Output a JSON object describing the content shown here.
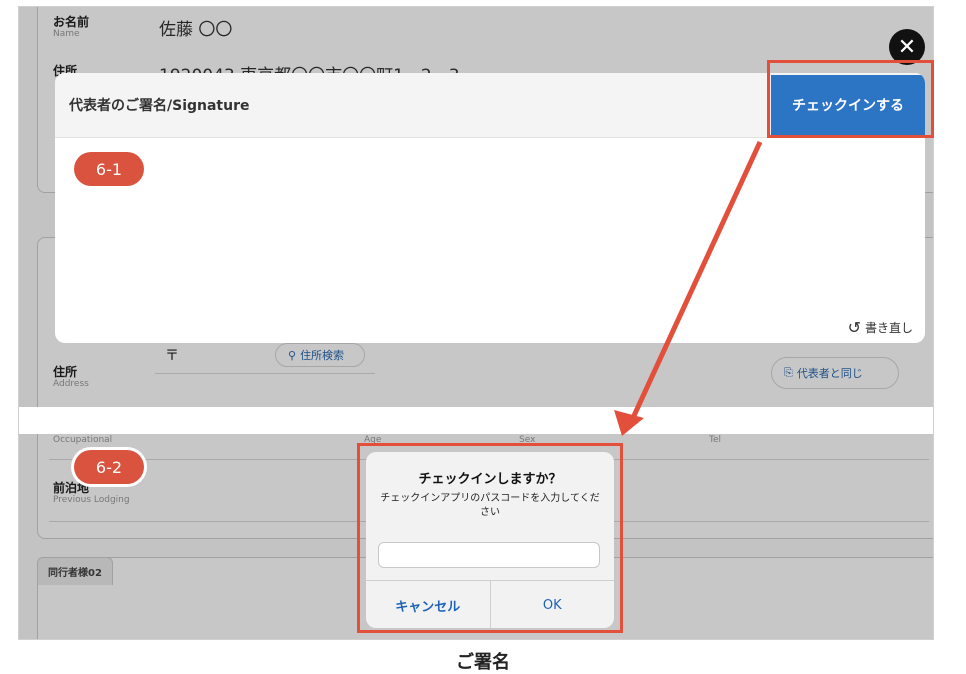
{
  "form": {
    "name_label": "お名前",
    "name_label_en": "Name",
    "name_value": "佐藤 〇〇",
    "address_label": "住所",
    "address_value_partial": "1920043 東京都〇〇市〇〇町1ー2ー3",
    "postal_mark": "〒",
    "address_search_label": "住所検索",
    "companion_address_label": "住所",
    "companion_address_label_en": "Address",
    "same_as_representative_label": "代表者と同じ",
    "occupation_label_en": "Occupational",
    "age_label_en": "Age",
    "sex_label_en": "Sex",
    "tel_label_en": "Tel",
    "previous_lodging_label": "前泊地",
    "previous_lodging_label_en": "Previous Lodging",
    "companion02_tab": "同行者様02"
  },
  "signature_modal": {
    "title": "代表者のご署名/Signature",
    "checkin_button": "チェックインする",
    "redo_label": "書き直し",
    "close_icon": "close-icon"
  },
  "annotations": {
    "step_6_1": "6-1",
    "step_6_2": "6-2",
    "frame_color": "#e2503c",
    "badge_color": "#d9533f"
  },
  "confirm_dialog": {
    "title": "チェックインしますか？",
    "message": "チェックインアプリのパスコードを入力してください",
    "input_value": "",
    "cancel_label": "キャンセル",
    "ok_label": "OK"
  },
  "caption": "ご署名"
}
